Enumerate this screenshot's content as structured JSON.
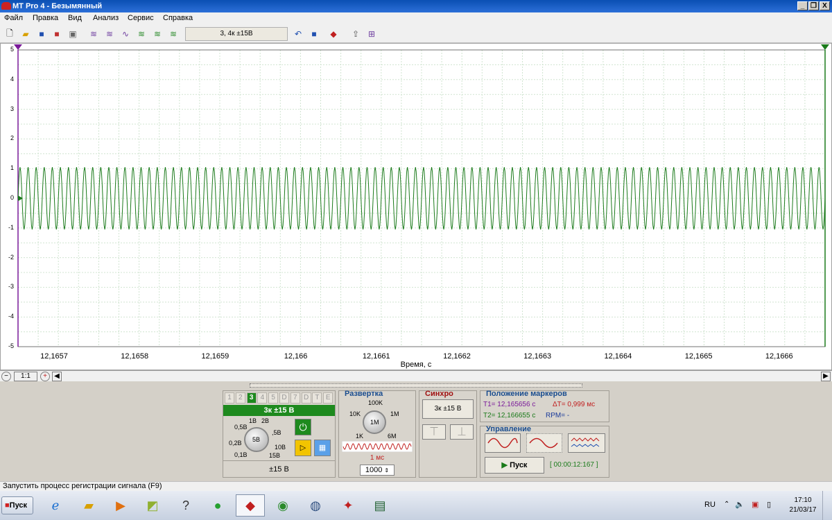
{
  "window": {
    "title": "MT Pro 4 - Безымянный",
    "min_label": "_",
    "restore_label": "❐",
    "close_label": "X"
  },
  "menu": {
    "items": [
      {
        "label": "Файл"
      },
      {
        "label": "Правка"
      },
      {
        "label": "Вид"
      },
      {
        "label": "Анализ"
      },
      {
        "label": "Сервис"
      },
      {
        "label": "Справка"
      }
    ]
  },
  "toolbar": {
    "range_combo": "3, 4к ±15В"
  },
  "plot": {
    "y_ticks": [
      "5",
      "4",
      "3",
      "2",
      "1",
      "0",
      "-1",
      "-2",
      "-3",
      "-4",
      "-5"
    ],
    "x_ticks": [
      "12,1657",
      "12,1658",
      "12,1659",
      "12,166",
      "12,1661",
      "12,1662",
      "12,1663",
      "12,1664",
      "12,1665",
      "12,1666"
    ],
    "x_title": "Время, с",
    "trace_color": "#1a7a1a",
    "grid_color": "#d0e4d0"
  },
  "chart_data": {
    "type": "line",
    "xlabel": "Время, с",
    "ylabel": "",
    "ylim": [
      -5,
      5
    ],
    "xlim": [
      12.165656,
      12.166655
    ],
    "series": [
      {
        "waveform": "sine",
        "amplitude": 1.05,
        "offset": 0.0,
        "cycles_visible": 100
      }
    ],
    "grid": true
  },
  "scroll": {
    "zoom_label": "1:1"
  },
  "channel": {
    "tabs": [
      "1",
      "2",
      "3",
      "4",
      "5",
      "D",
      "7",
      "D",
      "T",
      "E"
    ],
    "active_index": 2,
    "header": "3к ±15 В",
    "knob_labels": [
      "0,5В",
      "1В",
      "2В",
      ",5В",
      "0,2В",
      "10В",
      "0,1В",
      "15В"
    ],
    "knob_center": "5В",
    "footer": "±15 В"
  },
  "sweep": {
    "title": "Развертка",
    "knob_labels": [
      "100K",
      "10K",
      "1M",
      "1K",
      "6M"
    ],
    "knob_center": "1M",
    "time_label": "1 мс",
    "points": "1000"
  },
  "sync": {
    "title": "Синхро",
    "source": "3к ±15 В"
  },
  "markers": {
    "title": "Положение маркеров",
    "t1": "T1= 12,165656 с",
    "dt": "ΔT= 0,999 мс",
    "t2": "T2= 12,166655 с",
    "rpm": "RPM= -"
  },
  "control": {
    "title": "Управление",
    "start_label": "Пуск",
    "timer": "[ 00:00:12:167 ]"
  },
  "status": {
    "text": "Запустить процесс регистрации сигнала (F9)"
  },
  "taskbar": {
    "start_label": "Пуск",
    "lang": "RU",
    "time": "17:10",
    "date": "21/03/17"
  }
}
